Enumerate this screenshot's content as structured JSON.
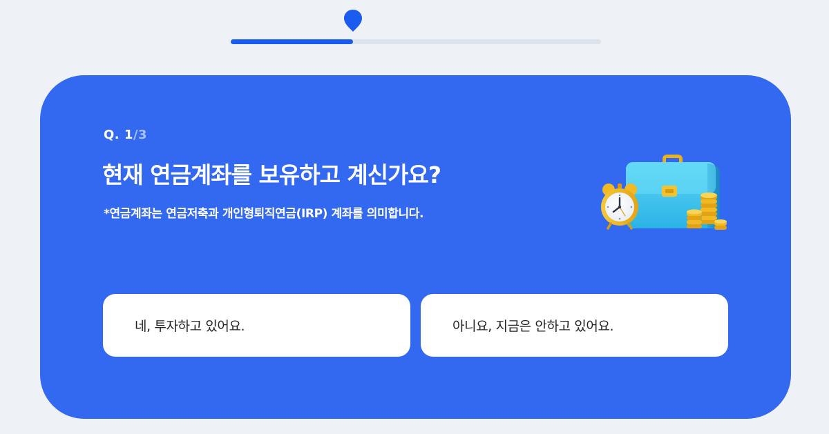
{
  "progress": {
    "fraction": 0.33,
    "accent_color": "#1b5cf0",
    "track_color": "#dde3ec"
  },
  "card": {
    "background_color": "#3368f0",
    "question_prefix": "Q. 1",
    "question_total": "/3",
    "title": "현재 연금계좌를 보유하고 계신가요?",
    "note": "*연금계좌는 연금저축과 개인형퇴직연금(IRP) 계좌를 의미합니다.",
    "illustration": {
      "icons": [
        "alarm-clock-icon",
        "briefcase-icon",
        "coin-stack-icon"
      ]
    }
  },
  "options": [
    {
      "label": "네, 투자하고 있어요."
    },
    {
      "label": "아니요, 지금은 안하고 있어요."
    }
  ]
}
